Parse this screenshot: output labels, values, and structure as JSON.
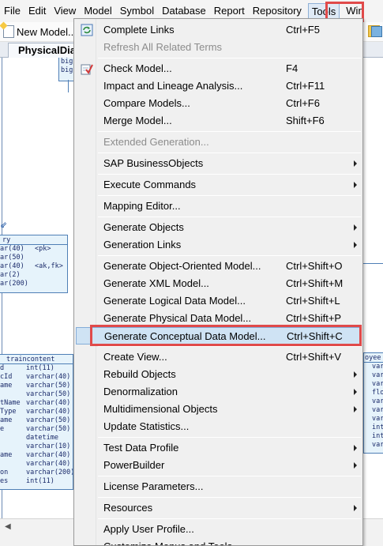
{
  "menubar": {
    "items": [
      "File",
      "Edit",
      "View",
      "Model",
      "Symbol",
      "Database",
      "Report",
      "Repository",
      "Tools",
      "Win"
    ],
    "active": "Tools"
  },
  "toolbar": {
    "new_model_label": "New Model..."
  },
  "tabs": {
    "active_label": "PhysicalDia"
  },
  "diagram": {
    "top_table": {
      "rows": [
        "big",
        "big"
      ]
    },
    "left_table": {
      "title": "ry",
      "rows": [
        [
          "ar(40)",
          "<pk>"
        ],
        [
          "ar(50)",
          ""
        ],
        [
          "ar(40)",
          "<ak,fk>"
        ],
        [
          "ar(2)",
          ""
        ],
        [
          "ar(200)",
          ""
        ]
      ]
    },
    "traincontent": {
      "title": "traincontent",
      "rows": [
        [
          "d",
          "int(11)"
        ],
        [
          "cId",
          "varchar(40)"
        ],
        [
          "ame",
          "varchar(50)"
        ],
        [
          "",
          "varchar(50)"
        ],
        [
          "tName",
          "varchar(40)"
        ],
        [
          "Type",
          "varchar(40)"
        ],
        [
          "ame",
          "varchar(50)"
        ],
        [
          "e",
          "varchar(50)"
        ],
        [
          "",
          "datetime"
        ],
        [
          "",
          "varchar(10)"
        ],
        [
          "ame",
          "varchar(40)"
        ],
        [
          "",
          "varchar(40)"
        ],
        [
          "on",
          "varchar(200)"
        ],
        [
          "es",
          "int(11)"
        ]
      ]
    },
    "right_table": {
      "title": "oyee",
      "rows": [
        "var",
        "var",
        "var",
        "flo",
        "var",
        "var",
        "var",
        "int",
        "int",
        "var"
      ]
    }
  },
  "tools_menu": {
    "items": [
      {
        "label": "Complete Links",
        "shortcut": "Ctrl+F5",
        "icon": "complete-links-icon"
      },
      {
        "label": "Refresh All Related Terms",
        "shortcut": "",
        "disabled": true
      },
      {
        "sep": true
      },
      {
        "label": "Check Model...",
        "shortcut": "F4",
        "icon": "check-model-icon"
      },
      {
        "label": "Impact and Lineage Analysis...",
        "shortcut": "Ctrl+F11"
      },
      {
        "label": "Compare Models...",
        "shortcut": "Ctrl+F6"
      },
      {
        "label": "Merge Model...",
        "shortcut": "Shift+F6"
      },
      {
        "sep": true
      },
      {
        "label": "Extended Generation...",
        "shortcut": "",
        "disabled": true
      },
      {
        "sep": true
      },
      {
        "label": "SAP BusinessObjects",
        "submenu": true
      },
      {
        "sep": true
      },
      {
        "label": "Execute Commands",
        "submenu": true
      },
      {
        "sep": true
      },
      {
        "label": "Mapping Editor..."
      },
      {
        "sep": true
      },
      {
        "label": "Generate Objects",
        "submenu": true
      },
      {
        "label": "Generation Links",
        "submenu": true
      },
      {
        "sep": true
      },
      {
        "label": "Generate Object-Oriented Model...",
        "shortcut": "Ctrl+Shift+O"
      },
      {
        "label": "Generate XML Model...",
        "shortcut": "Ctrl+Shift+M"
      },
      {
        "label": "Generate Logical Data Model...",
        "shortcut": "Ctrl+Shift+L"
      },
      {
        "label": "Generate Physical Data Model...",
        "shortcut": "Ctrl+Shift+P"
      },
      {
        "label": "Generate Conceptual Data Model...",
        "shortcut": "Ctrl+Shift+C",
        "highlighted": true
      },
      {
        "sep": true
      },
      {
        "label": "Create View...",
        "shortcut": "Ctrl+Shift+V"
      },
      {
        "label": "Rebuild Objects",
        "submenu": true
      },
      {
        "label": "Denormalization",
        "submenu": true
      },
      {
        "label": "Multidimensional Objects",
        "submenu": true
      },
      {
        "label": "Update Statistics..."
      },
      {
        "sep": true
      },
      {
        "label": "Test Data Profile",
        "submenu": true
      },
      {
        "label": "PowerBuilder",
        "submenu": true
      },
      {
        "sep": true
      },
      {
        "label": "License Parameters..."
      },
      {
        "sep": true
      },
      {
        "label": "Resources",
        "submenu": true
      },
      {
        "sep": true
      },
      {
        "label": "Apply User Profile..."
      },
      {
        "label": "Customize Menus and Tools..."
      }
    ]
  },
  "colors": {
    "highlight_bg": "#cfe3f4",
    "highlight_border": "#84acd8",
    "annotation_red": "#e04a4a",
    "table_fill": "#e6f3fb",
    "table_border": "#4f7fb6"
  }
}
